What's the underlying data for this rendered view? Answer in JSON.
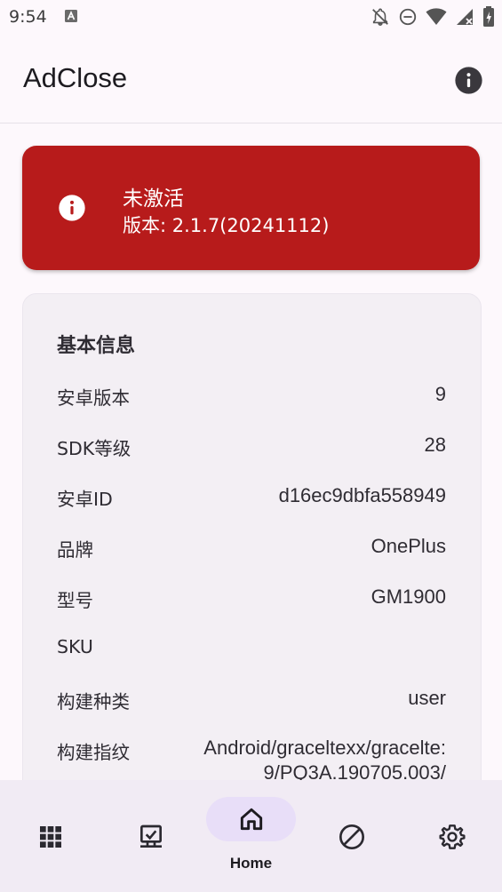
{
  "status_bar": {
    "time": "9:54"
  },
  "app_bar": {
    "title": "AdClose",
    "info_icon": "info-icon"
  },
  "status_card": {
    "title": "未激活",
    "version": "版本: 2.1.7(20241112)",
    "color": "#b71b1b"
  },
  "info": {
    "header": "基本信息",
    "rows": [
      {
        "key": "安卓版本",
        "value": "9"
      },
      {
        "key": "SDK等级",
        "value": "28"
      },
      {
        "key": "安卓ID",
        "value": "d16ec9dbfa558949"
      },
      {
        "key": "品牌",
        "value": "OnePlus"
      },
      {
        "key": "型号",
        "value": "GM1900"
      },
      {
        "key": "SKU",
        "value": ""
      },
      {
        "key": "构建种类",
        "value": "user"
      },
      {
        "key": "构建指纹",
        "value": "Android/graceltexx/gracelte:\n9/PQ3A.190705.003/"
      }
    ]
  },
  "bottom_nav": {
    "items": [
      {
        "icon": "apps-grid-icon"
      },
      {
        "icon": "install-desktop-icon"
      },
      {
        "icon": "home-icon",
        "label": "Home",
        "selected": true
      },
      {
        "icon": "block-icon"
      },
      {
        "icon": "settings-gear-icon"
      }
    ],
    "active_label": "Home",
    "pill_color": "#e8def8"
  }
}
